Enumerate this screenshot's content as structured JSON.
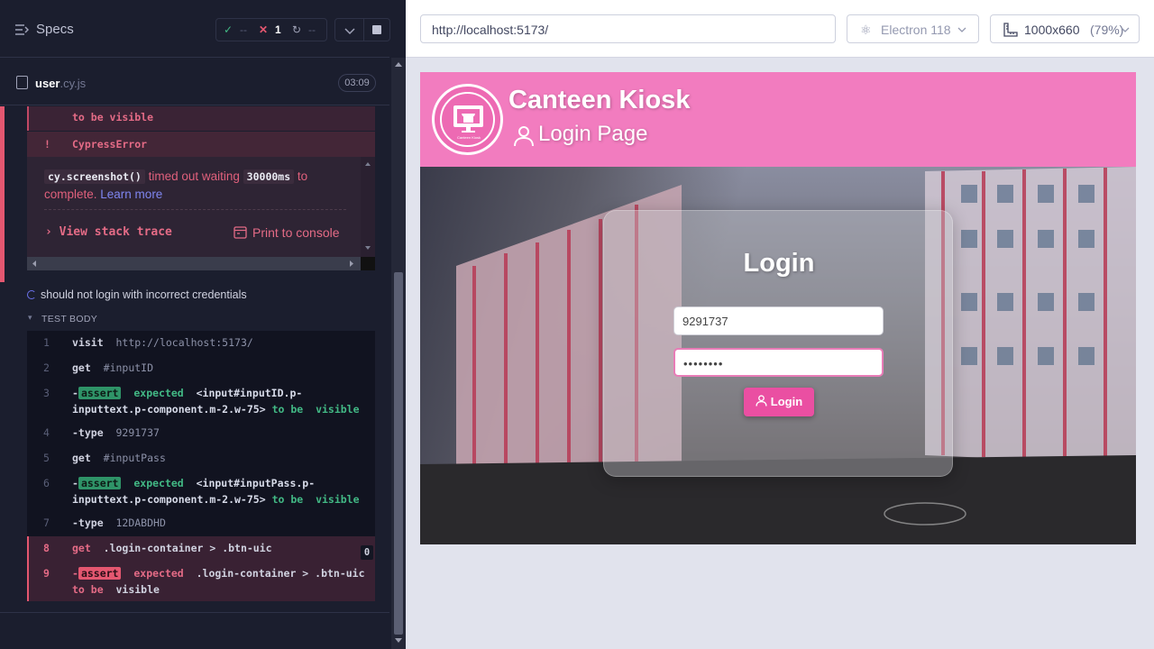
{
  "runner": {
    "specs_title": "Specs",
    "stats": {
      "passed": "--",
      "failed": "1",
      "pending": "--"
    },
    "file": {
      "name": "user",
      "ext": ".cy.js",
      "duration": "03:09"
    },
    "error": {
      "prev_line": "to be visible",
      "marker": "!",
      "type": "CypressError",
      "cmd": "cy.screenshot()",
      "text1": " timed out waiting ",
      "ms": "30000ms",
      "text2": " to complete. ",
      "learn_more": "Learn more",
      "stack_trace": "View stack trace",
      "print_console": "Print to console"
    },
    "test_title": "should not login with incorrect credentials",
    "test_body_label": "TEST BODY",
    "commands": [
      {
        "num": "1",
        "name": "visit",
        "arg": "http://localhost:5173/"
      },
      {
        "num": "2",
        "name": "get",
        "arg": "#inputID"
      },
      {
        "num": "3",
        "name": "-assert",
        "badge": "assert",
        "pre": "expected",
        "sel": "<input#inputID.p-inputtext.p-component.m-2.w-75>",
        "post": "to be",
        "post2": "visible"
      },
      {
        "num": "4",
        "name": "-type",
        "arg": "9291737"
      },
      {
        "num": "5",
        "name": "get",
        "arg": "#inputPass"
      },
      {
        "num": "6",
        "name": "-assert",
        "badge": "assert",
        "pre": "expected",
        "sel": "<input#inputPass.p-inputtext.p-component.m-2.w-75>",
        "post": "to be",
        "post2": "visible"
      },
      {
        "num": "7",
        "name": "-type",
        "arg": "12DABDHD"
      }
    ],
    "failed_commands": [
      {
        "num": "8",
        "name": "get",
        "arg": ".login-container > .btn-uic",
        "count": "0"
      },
      {
        "num": "9",
        "badge": "assert",
        "pre": "expected",
        "sel": ".login-container > .btn-uic",
        "post": "to be",
        "post2": "visible"
      }
    ]
  },
  "aut": {
    "url": "http://localhost:5173/",
    "browser": "Electron 118",
    "viewport": "1000x660",
    "zoom": "(79%)"
  },
  "app": {
    "title": "Canteen Kiosk",
    "subtitle": "Login Page",
    "login_heading": "Login",
    "id_value": "9291737",
    "password_mask": "••••••••",
    "login_button": "Login",
    "logo_caption": "Canteen Kiosk"
  },
  "colors": {
    "runner_bg": "#1b1e2e",
    "fail": "#e45770",
    "pass": "#2f9468",
    "header_pink": "#f27cbf",
    "button_pink": "#ea4fa2"
  },
  "icons": [
    "specs-icon",
    "check-icon",
    "x-icon",
    "spinner-icon",
    "chevron-down-icon",
    "stop-icon",
    "file-icon",
    "console-icon",
    "user-icon",
    "electron-icon",
    "ruler-icon",
    "monitor-store-icon"
  ]
}
